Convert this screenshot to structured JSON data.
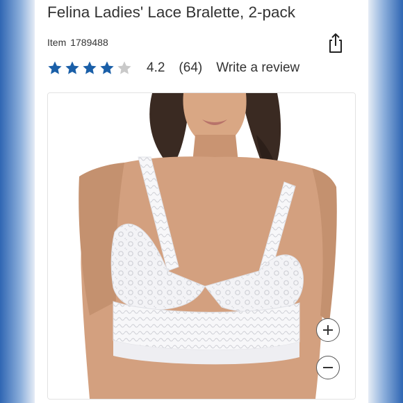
{
  "product": {
    "title": "Felina Ladies' Lace Bralette, 2-pack",
    "item_label": "Item",
    "item_number": "1789488"
  },
  "rating": {
    "value": "4.2",
    "count": "(64)",
    "stars_filled": 4,
    "stars_total": 5,
    "write_review_label": "Write a review"
  },
  "icons": {
    "share": "share-icon",
    "zoom_in": "plus-icon",
    "zoom_out": "minus-icon"
  },
  "colors": {
    "star_filled": "#1a5fa8",
    "star_empty": "#c9c9c9",
    "text": "#333333",
    "background_side": "#2f66b3"
  }
}
